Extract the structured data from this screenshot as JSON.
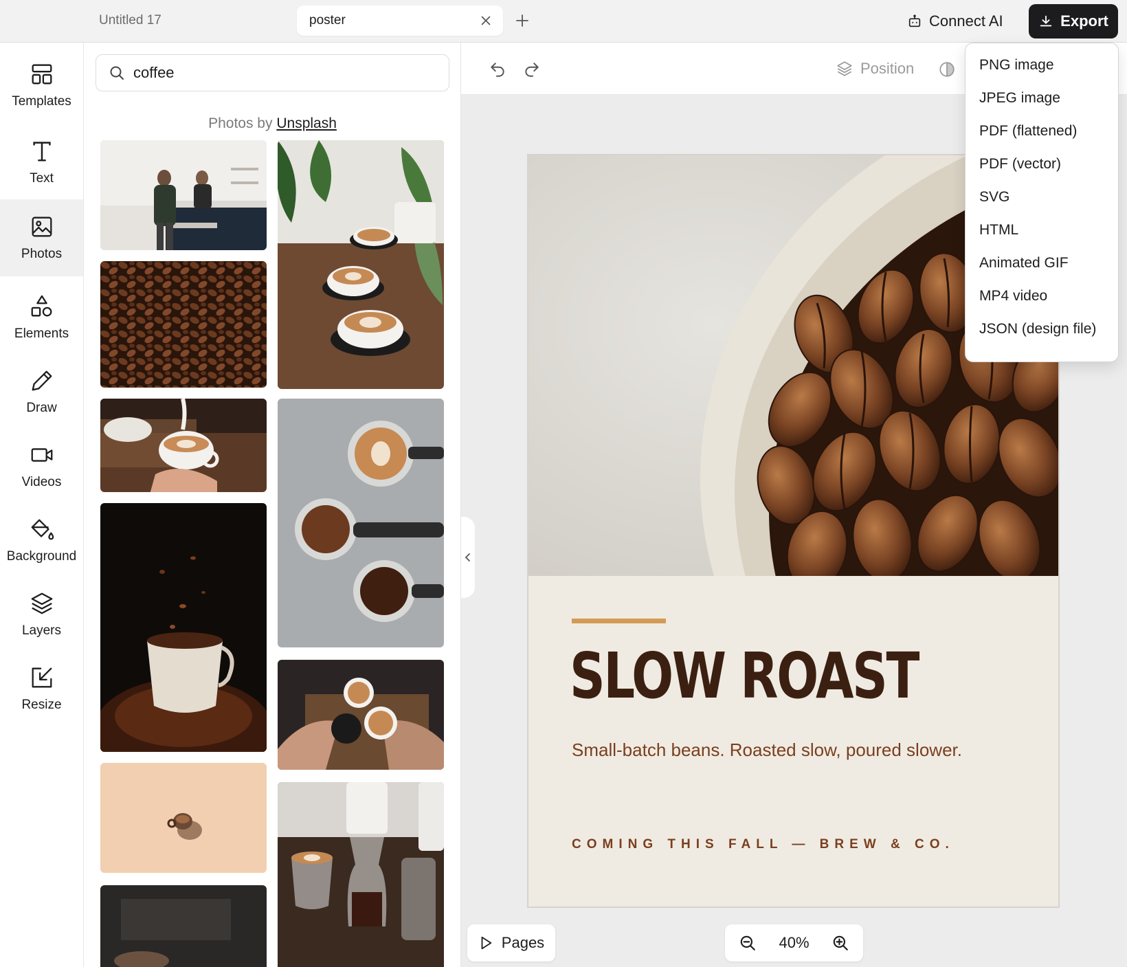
{
  "tabs": [
    {
      "label": "Untitled 17",
      "active": false
    },
    {
      "label": "poster",
      "active": true
    }
  ],
  "header": {
    "connect_label": "Connect AI",
    "export_label": "Export"
  },
  "rail": [
    {
      "label": "Templates",
      "icon": "templates-icon"
    },
    {
      "label": "Text",
      "icon": "text-icon"
    },
    {
      "label": "Photos",
      "icon": "photos-icon",
      "active": true
    },
    {
      "label": "Elements",
      "icon": "elements-icon"
    },
    {
      "label": "Draw",
      "icon": "pencil-icon"
    },
    {
      "label": "Videos",
      "icon": "video-icon"
    },
    {
      "label": "Background",
      "icon": "paint-bucket-icon"
    },
    {
      "label": "Layers",
      "icon": "layers-icon"
    },
    {
      "label": "Resize",
      "icon": "resize-icon"
    }
  ],
  "search": {
    "value": "coffee",
    "placeholder": "Search photos"
  },
  "credit": {
    "prefix": "Photos by",
    "link": "Unsplash"
  },
  "toolbar": {
    "position_label": "Position"
  },
  "poster": {
    "headline": "SLOW ROAST",
    "tagline": "Small-batch beans. Roasted slow, poured slower.",
    "footer": "COMING THIS FALL — BREW & CO.",
    "colors": {
      "accent": "#d39a55",
      "headline": "#3b2012",
      "tagline": "#7a3f1f",
      "footer": "#7a3f1f",
      "background": "#f0ebe2"
    }
  },
  "bottom": {
    "pages_label": "Pages",
    "zoom_label": "40%"
  },
  "export_menu": [
    "PNG image",
    "JPEG image",
    "PDF (flattened)",
    "PDF (vector)",
    "SVG",
    "HTML",
    "Animated GIF",
    "MP4 video",
    "JSON (design file)"
  ]
}
